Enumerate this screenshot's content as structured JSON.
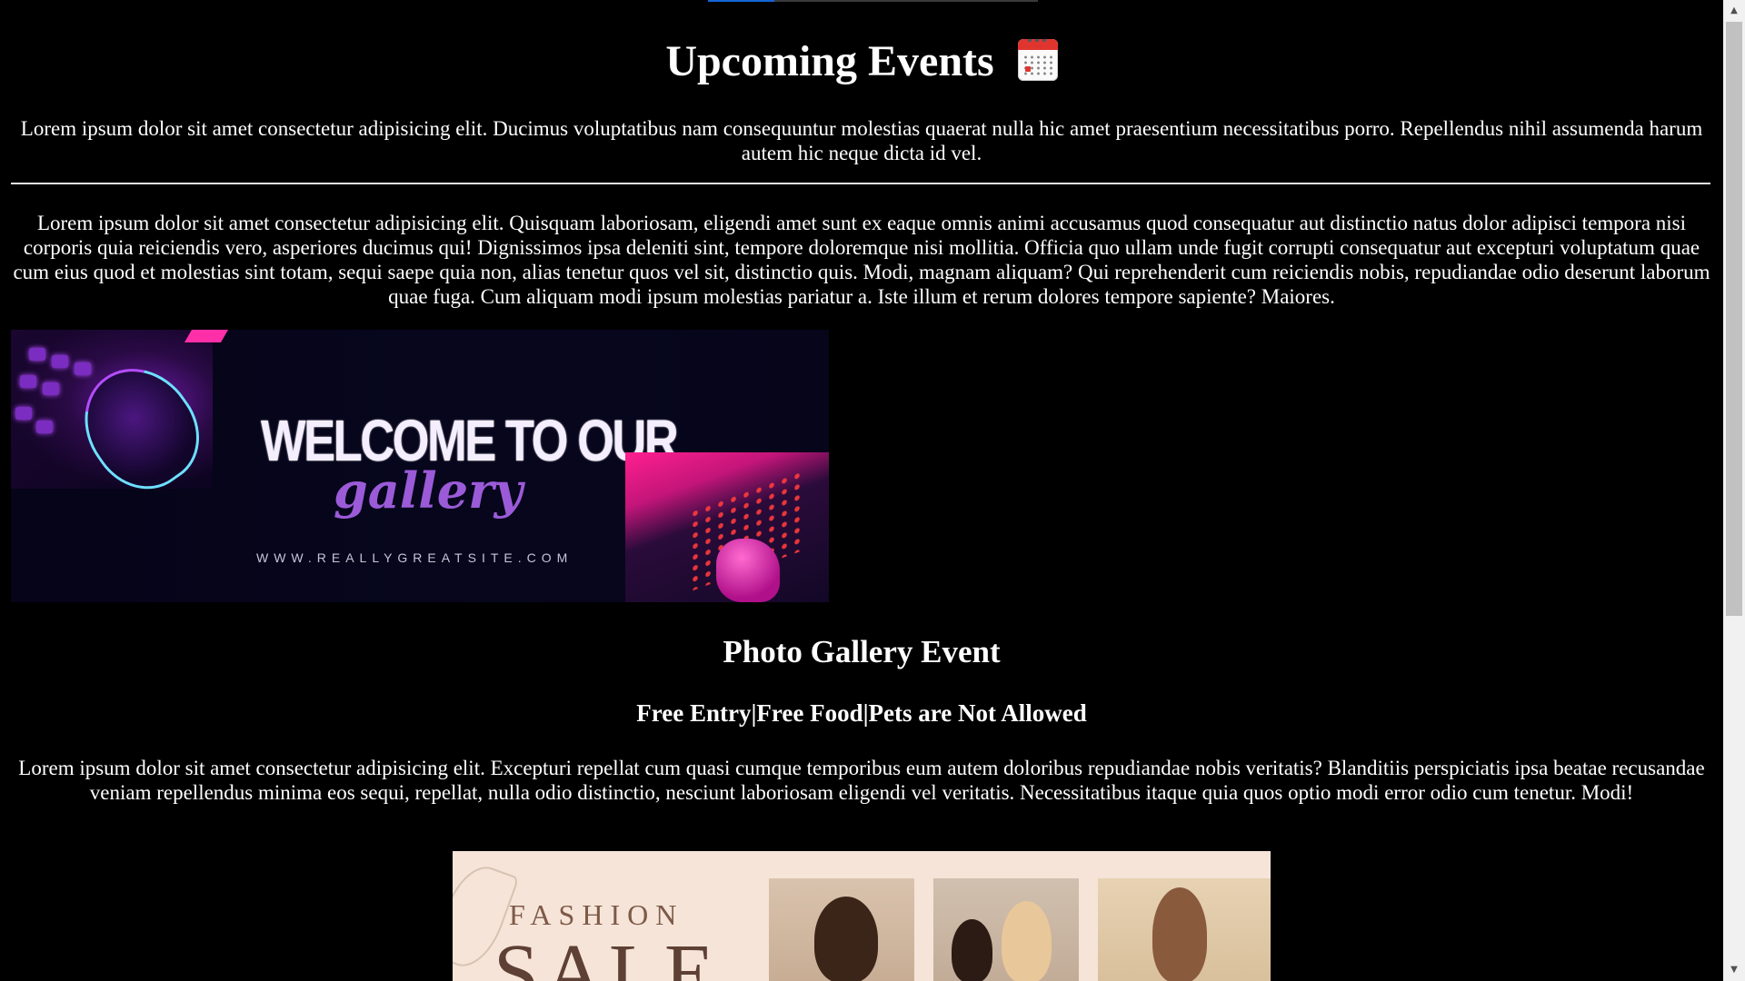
{
  "header": {
    "title": "Upcoming Events",
    "title_icon": "calendar-icon",
    "intro": "Lorem ipsum dolor sit amet consectetur adipisicing elit. Ducimus voluptatibus nam consequuntur molestias quaerat nulla hic amet praesentium necessitatibus porro. Repellendus nihil assumenda harum autem hic neque dicta id vel."
  },
  "body_text": "Lorem ipsum dolor sit amet consectetur adipisicing elit. Quisquam laboriosam, eligendi amet sunt ex eaque omnis animi accusamus quod consequatur aut distinctio natus dolor adipisci tempora nisi corporis quia reiciendis vero, asperiores ducimus qui! Dignissimos ipsa deleniti sint, tempore doloremque nisi mollitia. Officia quo ullam unde fugit corrupti consequatur aut excepturi voluptatum quae cum eius quod et molestias sint totam, sequi saepe quia non, alias tenetur quos vel sit, distinctio quis. Modi, magnam aliquam? Qui reprehenderit cum reiciendis nobis, repudiandae odio deserunt laborum quae fuga. Cum aliquam modi ipsum molestias pariatur a. Iste illum et rerum dolores tempore sapiente? Maiores.",
  "gallery_banner": {
    "title": "WELCOME TO OUR",
    "script": "gallery",
    "url": "WWW.REALLYGREATSITE.COM"
  },
  "event": {
    "title": "Photo Gallery Event",
    "subtitle": "Free Entry|Free Food|Pets are Not Allowed",
    "description": "Lorem ipsum dolor sit amet consectetur adipisicing elit. Excepturi repellat cum quasi cumque temporibus eum autem doloribus repudiandae nobis veritatis? Blanditiis perspiciatis ipsa beatae recusandae veniam repellendus minima eos sequi, repellat, nulla odio distinctio, nesciunt laboriosam eligendi vel veritatis. Necessitatibus itaque quia quos optio modi error odio cum tenetur. Modi!"
  },
  "fashion_banner": {
    "label": "FASHION",
    "headline": "SALE"
  },
  "progress": {
    "fraction": 0.2
  },
  "colors": {
    "background": "#000000",
    "text": "#ffffff",
    "accent_progress": "#1565d8",
    "fashion_bg": "#f6e4d8"
  }
}
